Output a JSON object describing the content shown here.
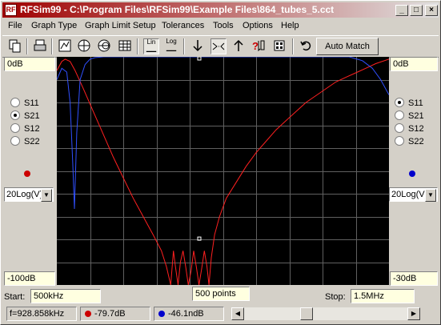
{
  "window": {
    "title": "RFSim99 - C:\\Program Files\\RFSim99\\Example Files\\864_tubes_5.cct",
    "app_icon_text": "RF",
    "minimize": "_",
    "maximize": "□",
    "close": "×"
  },
  "menu": [
    "File",
    "Graph Type",
    "Graph Limit Setup",
    "Tolerances",
    "Tools",
    "Options",
    "Help"
  ],
  "toolbar": {
    "icons": [
      "copy-icon",
      "print-icon",
      "rect-graph-icon",
      "polar-icon",
      "smith-chart-icon",
      "table-icon",
      "linear-scale-icon",
      "log-scale-icon",
      "down-arrow-icon",
      "narrow-icon",
      "up-arrow-icon",
      "help-pointer-icon",
      "component-icon",
      "undo-icon"
    ],
    "lin_label": "Lin",
    "log_label": "Log",
    "auto_match": "Auto Match"
  },
  "left_panel": {
    "top_value": "0dB",
    "bottom_value": "-100dB",
    "params": [
      "S11",
      "S21",
      "S12",
      "S22"
    ],
    "selected": "S21",
    "scale": "20Log(V)",
    "color": "#cc0000"
  },
  "right_panel": {
    "top_value": "0dB",
    "bottom_value": "-30dB",
    "params": [
      "S11",
      "S21",
      "S12",
      "S22"
    ],
    "selected": "S11",
    "scale": "20Log(V)",
    "color": "#0000cc"
  },
  "sweep": {
    "start_label": "Start:",
    "start_value": "500kHz",
    "points": "500 points",
    "stop_label": "Stop:",
    "stop_value": "1.5MHz"
  },
  "status": {
    "frequency": "f=928.858kHz",
    "red_value": "-79.7dB",
    "blue_value": "-46.1ndB"
  },
  "chart_data": {
    "type": "line",
    "xlim": [
      500,
      1500
    ],
    "xunit": "kHz",
    "grid": true,
    "series": [
      {
        "color": "#ff2020",
        "axis": "left",
        "ylim": [
          -100,
          0
        ],
        "x": [
          500,
          515,
          525,
          540,
          555,
          580,
          610,
          640,
          670,
          700,
          730,
          760,
          790,
          815,
          830,
          843,
          851,
          857,
          865,
          872,
          880,
          888,
          896,
          904,
          912,
          920,
          928,
          936,
          944,
          952,
          958,
          965,
          975,
          990,
          1010,
          1040,
          1070,
          1100,
          1130,
          1160,
          1190,
          1220,
          1250,
          1280,
          1310,
          1340,
          1370,
          1400,
          1430,
          1460,
          1500
        ],
        "y": [
          -6,
          -2,
          -1,
          -2,
          -6,
          -14,
          -24,
          -34,
          -44,
          -53,
          -62,
          -70,
          -78,
          -85,
          -92,
          -100,
          -85,
          -92,
          -100,
          -90,
          -85,
          -92,
          -100,
          -94,
          -85,
          -92,
          -100,
          -93,
          -85,
          -92,
          -100,
          -88,
          -78,
          -70,
          -62,
          -55,
          -48,
          -42,
          -37,
          -32,
          -28,
          -24,
          -20,
          -17,
          -14,
          -11,
          -9,
          -7,
          -5,
          -3,
          -1
        ]
      },
      {
        "color": "#3050ff",
        "axis": "right",
        "ylim": [
          -30,
          0
        ],
        "x": [
          500,
          515,
          530,
          540,
          548,
          553,
          560,
          570,
          585,
          600,
          615,
          640,
          700,
          800,
          900,
          1000,
          1100,
          1200,
          1300,
          1380,
          1420,
          1450,
          1475,
          1500
        ],
        "y": [
          -3,
          -1.5,
          -2,
          -6,
          -14,
          -20,
          -10,
          -3,
          -1,
          -0.3,
          -0.1,
          0,
          0,
          0,
          0,
          0,
          0,
          0,
          0,
          0,
          -0.5,
          -1.5,
          -3,
          -5
        ]
      }
    ],
    "markers": [
      {
        "x": 928.858,
        "y": -79.7,
        "axis": "left"
      },
      {
        "x": 928.858,
        "y": 0,
        "axis": "left"
      }
    ]
  }
}
